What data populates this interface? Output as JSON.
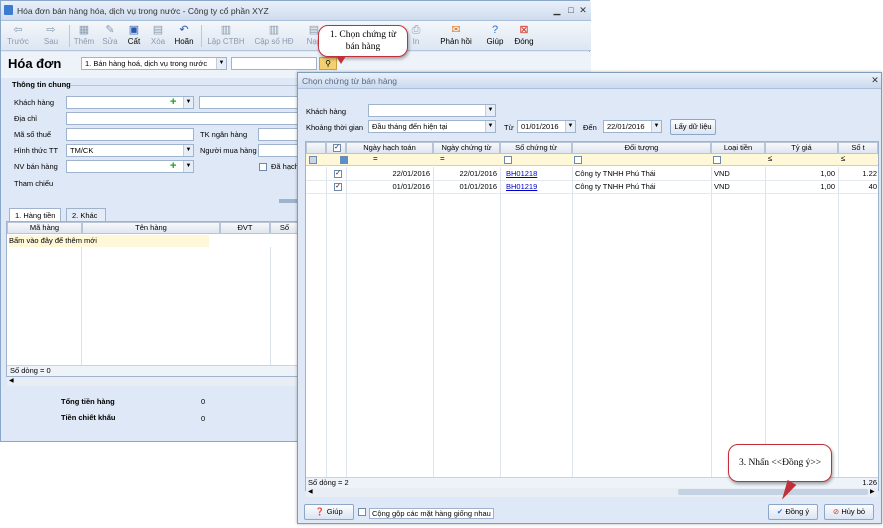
{
  "main": {
    "title": "Hóa đơn bán hàng hóa, dịch vụ trong nước - Công ty cổ phần XYZ",
    "toolbar": [
      "Trước",
      "Sau",
      "Thêm",
      "Sửa",
      "Cất",
      "Xóa",
      "Hoãn",
      "Lập CTBH",
      "Cập số HĐ",
      "Nạp",
      "In",
      "Phản hồi",
      "Giúp",
      "Đóng"
    ],
    "page_title": "Hóa đơn",
    "invoice_type": "1. Bán hàng hoá, dịch vụ trong nước",
    "group_general": "Thông tin chung",
    "labels": {
      "customer": "Khách hàng",
      "address": "Địa chỉ",
      "tax_code": "Mã số thuế",
      "payment": "Hình thức TT",
      "salesperson": "NV bán hàng",
      "reference": "Tham chiếu",
      "bank_account": "TK ngân hàng",
      "buyer": "Người mua hàng",
      "issued": "Đã hạch"
    },
    "payment_value": "TM/CK",
    "tabs": [
      "1. Hàng tiền",
      "2. Khác"
    ],
    "grid_headers": [
      "Mã hàng",
      "Tên hàng",
      "ĐVT",
      "Số"
    ],
    "grid_hint": "Bấm vào đây để thêm mới",
    "row_count": "Số dòng = 0",
    "totals": [
      {
        "label": "Tổng tiền hàng",
        "value": "0"
      },
      {
        "label": "Tiền chiết khấu",
        "value": "0"
      }
    ]
  },
  "dialog": {
    "title": "Chọn chứng từ bán hàng",
    "customer_label": "Khách hàng",
    "period_label": "Khoảng thời gian",
    "period_value": "Đầu tháng đến hiện tại",
    "from_label": "Từ",
    "from_value": "01/01/2016",
    "to_label": "Đến",
    "to_value": "22/01/2016",
    "fetch_button": "Lấy dữ liệu",
    "columns": [
      "Ngày hạch toán",
      "Ngày chứng từ",
      "Số chứng từ",
      "Đối tượng",
      "Loại tiền",
      "Tỷ giá",
      "Số t"
    ],
    "rows": [
      {
        "posting_date": "22/01/2016",
        "doc_date": "22/01/2016",
        "doc_no": "BH01218",
        "partner": "Công ty TNHH Phú Thái",
        "currency": "VND",
        "rate": "1,00",
        "amount": "1.22"
      },
      {
        "posting_date": "01/01/2016",
        "doc_date": "01/01/2016",
        "doc_no": "BH01219",
        "partner": "Công ty TNHH Phú Thái",
        "currency": "VND",
        "rate": "1,00",
        "amount": "40"
      }
    ],
    "row_count": "Số dòng = 2",
    "footer_amount": "1.26",
    "help_button": "Giúp",
    "merge_label": "Cộng gộp các mặt hàng giống nhau",
    "ok_button": "Đồng ý",
    "cancel_button": "Hủy bỏ"
  },
  "callouts": {
    "step1": "1. Chọn chứng từ bán hàng",
    "step3": "3. Nhấn <<Đồng ý>>"
  }
}
